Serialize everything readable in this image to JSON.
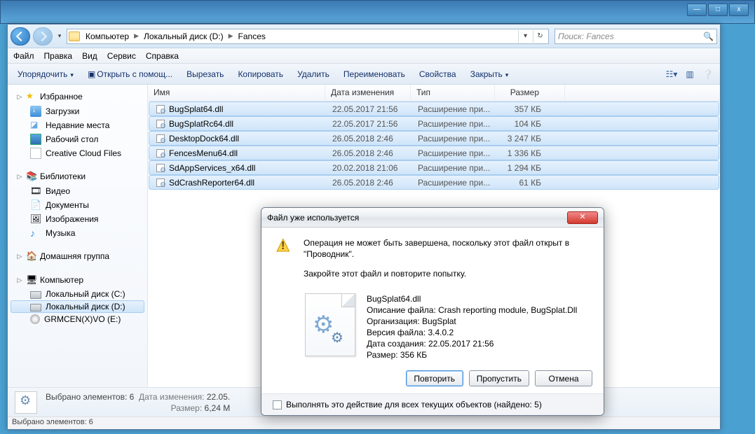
{
  "titlebar_buttons": {
    "min": "—",
    "max": "□",
    "close": "x"
  },
  "breadcrumbs": [
    "Компьютер",
    "Локальный диск (D:)",
    "Fances"
  ],
  "search_placeholder": "Поиск: Fances",
  "menubar": [
    "Файл",
    "Правка",
    "Вид",
    "Сервис",
    "Справка"
  ],
  "toolbar": {
    "organize": "Упорядочить",
    "openwith": "Открыть с помощ...",
    "cut": "Вырезать",
    "copy": "Копировать",
    "delete": "Удалить",
    "rename": "Переименовать",
    "props": "Свойства",
    "close": "Закрыть"
  },
  "sidebar": {
    "favorites": "Избранное",
    "downloads": "Загрузки",
    "recent": "Недавние места",
    "desktop": "Рабочий стол",
    "ccf": "Creative Cloud Files",
    "libraries": "Библиотеки",
    "video": "Видео",
    "documents": "Документы",
    "images": "Изображения",
    "music": "Музыка",
    "homegroup": "Домашняя группа",
    "computer": "Компьютер",
    "drive_c": "Локальный диск (C:)",
    "drive_d": "Локальный диск (D:)",
    "drive_e": "GRMCEN(X)VO (E:)"
  },
  "columns": {
    "name": "Имя",
    "date": "Дата изменения",
    "type": "Тип",
    "size": "Размер"
  },
  "files": [
    {
      "name": "BugSplat64.dll",
      "date": "22.05.2017 21:56",
      "type": "Расширение при...",
      "size": "357 КБ"
    },
    {
      "name": "BugSplatRc64.dll",
      "date": "22.05.2017 21:56",
      "type": "Расширение при...",
      "size": "104 КБ"
    },
    {
      "name": "DesktopDock64.dll",
      "date": "26.05.2018 2:46",
      "type": "Расширение при...",
      "size": "3 247 КБ"
    },
    {
      "name": "FencesMenu64.dll",
      "date": "26.05.2018 2:46",
      "type": "Расширение при...",
      "size": "1 336 КБ"
    },
    {
      "name": "SdAppServices_x64.dll",
      "date": "20.02.2018 21:06",
      "type": "Расширение при...",
      "size": "1 294 КБ"
    },
    {
      "name": "SdCrashReporter64.dll",
      "date": "26.05.2018 2:46",
      "type": "Расширение при...",
      "size": "61 КБ"
    }
  ],
  "details": {
    "selected_label": "Выбрано элементов: 6",
    "date_label": "Дата изменения:",
    "date_value": "22.05.",
    "size_label": "Размер:",
    "size_value": "6,24 М"
  },
  "statusbar": "Выбрано элементов: 6",
  "dialog": {
    "title": "Файл уже используется",
    "line1": "Операция не может быть завершена, поскольку этот файл открыт в \"Проводник\".",
    "line2": "Закройте этот файл и повторите попытку.",
    "file": {
      "name": "BugSplat64.dll",
      "desc": "Описание файла: Crash reporting module, BugSplat.Dll",
      "org": "Организация: BugSplat",
      "ver": "Версия файла: 3.4.0.2",
      "created": "Дата создания: 22.05.2017 21:56",
      "size": "Размер: 356 КБ"
    },
    "btn_retry": "Повторить",
    "btn_skip": "Пропустить",
    "btn_cancel": "Отмена",
    "apply_all": "Выполнять это действие для всех текущих объектов (найдено: 5)"
  }
}
